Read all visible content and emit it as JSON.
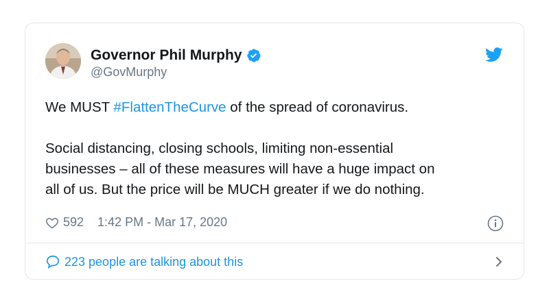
{
  "tweet": {
    "author": {
      "display_name": "Governor Phil Murphy",
      "handle": "@GovMurphy",
      "verified": true
    },
    "text": {
      "line1_before": "We MUST ",
      "hashtag": "#FlattenTheCurve",
      "line1_after": " of the spread of coronavirus.",
      "paragraph2_line1": "Social distancing, closing schools, limiting non-essential",
      "paragraph2_line2": "businesses – all of these measures will have a huge impact on",
      "paragraph2_line3": "all of us. But the price will be MUCH greater if we do nothing."
    },
    "likes": "592",
    "timestamp": "1:42 PM - Mar 17, 2020",
    "conversation_label": "223 people are talking about this"
  },
  "icons": {
    "brand": "twitter-bird-icon",
    "verified": "verified-badge-icon",
    "like": "heart-icon",
    "info": "info-icon",
    "conversation": "speech-bubble-icon",
    "navigate": "chevron-right-icon"
  },
  "colors": {
    "accent": "#1b95e0",
    "text": "#14171a",
    "muted": "#657786",
    "border": "#e1e8ed"
  }
}
